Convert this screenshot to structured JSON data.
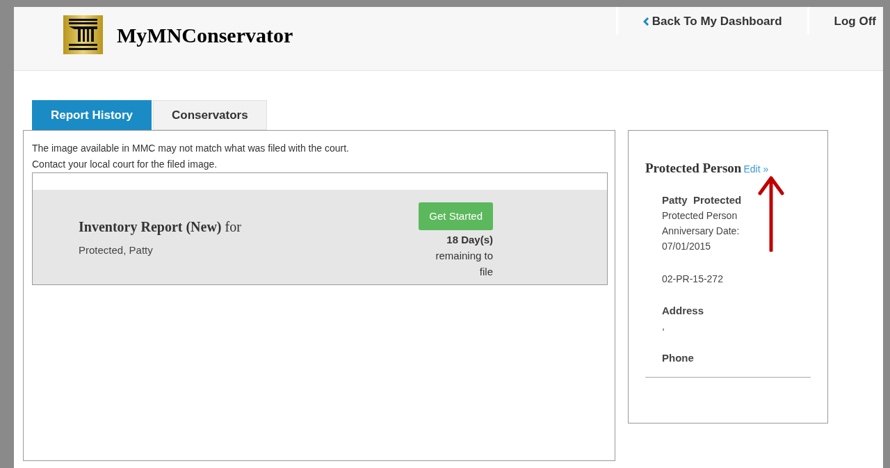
{
  "header": {
    "brand": "MyMNConservator",
    "nav": [
      {
        "label": "Back To My Dashboard",
        "kind": "back"
      },
      {
        "label": "Log Off",
        "kind": "plain"
      }
    ]
  },
  "tabs": [
    {
      "label": "Report History",
      "selected": true
    },
    {
      "label": "Conservators",
      "selected": false
    }
  ],
  "notice": [
    "The image available in MMC may not match what was filed with the court.",
    "Contact your local court for the filed image."
  ],
  "report": {
    "title": "**Inventory Report (New)** for",
    "person": "Protected, Patty",
    "button": "Get Started",
    "due": "**18 Day(s)** remaining to file"
  },
  "side_panel": {
    "title": "Protected Person",
    "edit": "Edit »",
    "name": "Patty  Protected",
    "role": "Protected Person",
    "anniversary_label": "Anniversary Date:",
    "anniversary_date": "07/01/2015",
    "case_number": "02-PR-15-272",
    "address_label": "Address",
    "address": ",",
    "phone_label": "Phone"
  }
}
